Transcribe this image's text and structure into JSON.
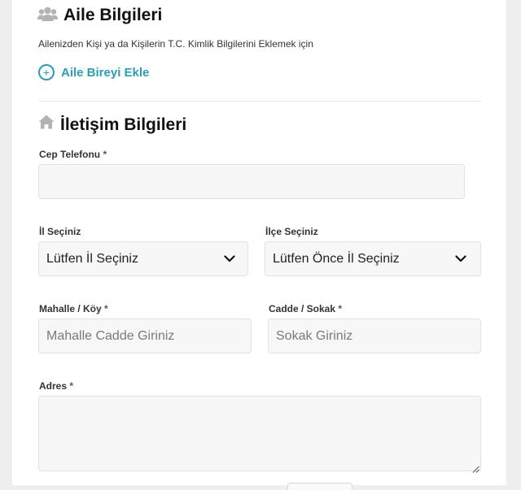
{
  "family": {
    "title": "Aile Bilgileri",
    "description": "Ailenizden Kişi ya da Kişilerin T.C. Kimlik Bilgilerini Eklemek için",
    "add_label": "Aile Bireyi Ekle",
    "add_symbol": "+",
    "icon": "users-icon"
  },
  "contact": {
    "title": "İletişim Bilgileri",
    "icon": "home-icon",
    "required_mark": "*",
    "phone": {
      "label": "Cep Telefonu",
      "value": "",
      "placeholder": ""
    },
    "province": {
      "label": "İl Seçiniz",
      "selected": "Lütfen İl Seçiniz"
    },
    "district": {
      "label": "İlçe Seçiniz",
      "selected": "Lütfen Önce İl Seçiniz"
    },
    "neighborhood": {
      "label": "Mahalle / Köy",
      "placeholder": "Mahalle Cadde Giriniz"
    },
    "street": {
      "label": "Cadde / Sokak",
      "placeholder": "Sokak Giriniz"
    },
    "address": {
      "label": "Adres",
      "value": ""
    }
  },
  "colors": {
    "accent": "#2a9db8",
    "icon_gray": "#b3b3b3",
    "field_bg": "#f7f7f7",
    "page_bg": "#eeeeee"
  }
}
